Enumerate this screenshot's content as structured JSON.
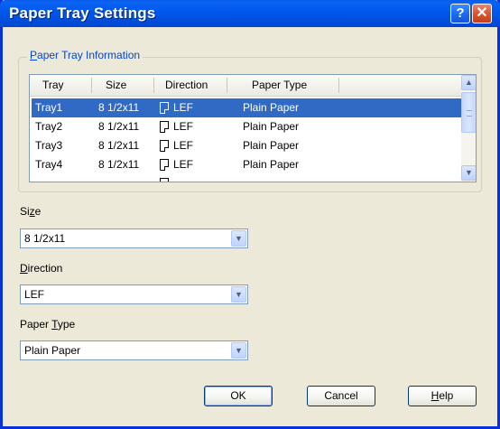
{
  "window": {
    "title": "Paper Tray Settings",
    "help_glyph": "?",
    "close_glyph": "✕"
  },
  "group": {
    "label_accel": "P",
    "label_rest": "aper Tray Information"
  },
  "table": {
    "columns": [
      "Tray",
      "Size",
      "Direction",
      "Paper Type"
    ],
    "rows": [
      {
        "tray": "Tray1",
        "size": "8 1/2x11",
        "direction": "LEF",
        "paper_type": "Plain Paper",
        "selected": true
      },
      {
        "tray": "Tray2",
        "size": "8 1/2x11",
        "direction": "LEF",
        "paper_type": "Plain Paper",
        "selected": false
      },
      {
        "tray": "Tray3",
        "size": "8 1/2x11",
        "direction": "LEF",
        "paper_type": "Plain Paper",
        "selected": false
      },
      {
        "tray": "Tray4",
        "size": "8 1/2x11",
        "direction": "LEF",
        "paper_type": "Plain Paper",
        "selected": false
      }
    ]
  },
  "fields": {
    "size": {
      "label_pre": "Si",
      "label_accel": "z",
      "label_post": "e",
      "value": "8 1/2x11"
    },
    "direction": {
      "label_pre": "",
      "label_accel": "D",
      "label_post": "irection",
      "value": "LEF"
    },
    "paper_type": {
      "label_pre": "Paper ",
      "label_accel": "T",
      "label_post": "ype",
      "value": "Plain Paper"
    }
  },
  "buttons": {
    "ok": "OK",
    "cancel": "Cancel",
    "help_accel": "H",
    "help_rest": "elp"
  },
  "icons": {
    "scroll_up": "▲",
    "scroll_down": "▼",
    "dropdown": "▼"
  }
}
